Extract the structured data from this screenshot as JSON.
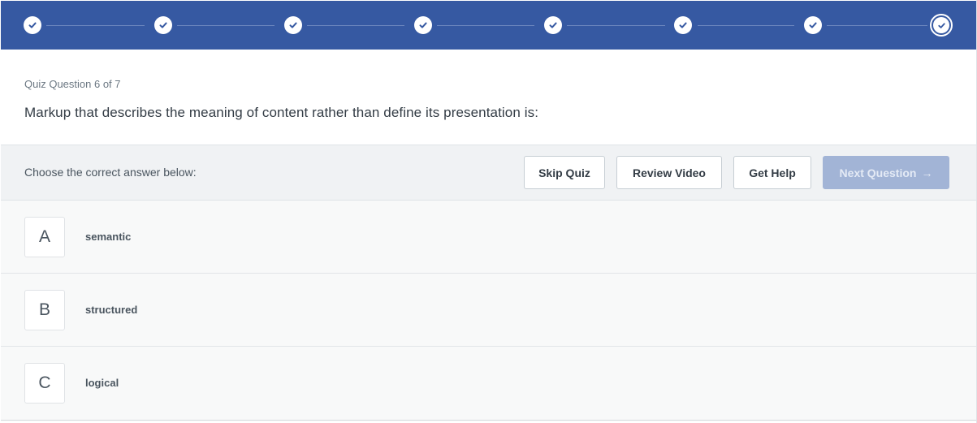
{
  "progress": {
    "total_steps": 8,
    "completed_steps": 7,
    "current_step": 8,
    "colors": {
      "bar": "#3659a2",
      "step": "#ffffff",
      "connector": "#6c86be"
    },
    "step_icon": "check-icon"
  },
  "question": {
    "counter": "Quiz Question 6 of 7",
    "text": "Markup that describes the meaning of content rather than define its presentation is:"
  },
  "toolbar": {
    "instruction": "Choose the correct answer below:",
    "skip_label": "Skip Quiz",
    "review_label": "Review Video",
    "help_label": "Get Help",
    "next_label": "Next Question",
    "next_icon": "arrow-right-icon",
    "next_disabled": true
  },
  "answers": [
    {
      "letter": "A",
      "text": "semantic"
    },
    {
      "letter": "B",
      "text": "structured"
    },
    {
      "letter": "C",
      "text": "logical"
    }
  ]
}
